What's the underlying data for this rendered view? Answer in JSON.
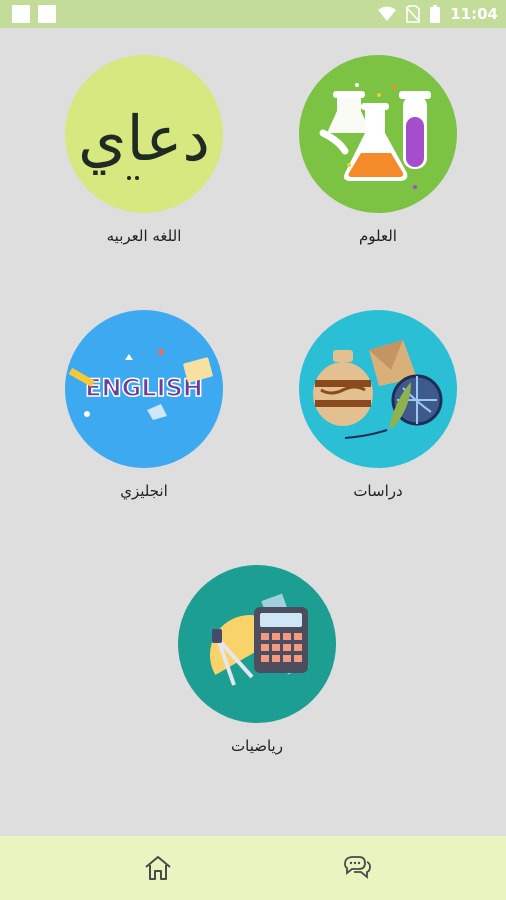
{
  "status_bar": {
    "time": "11:04",
    "icons": [
      "wifi-icon",
      "no-sim-icon",
      "battery-icon"
    ]
  },
  "subjects": [
    {
      "id": "science",
      "label": "العلوم",
      "icon": "chemistry-flasks-icon",
      "color": "#7cc243"
    },
    {
      "id": "arabic",
      "label": "اللغه العربيه",
      "icon": "arabic-calligraphy-icon",
      "color": "#d6e87f"
    },
    {
      "id": "studies",
      "label": "دراسات",
      "icon": "pottery-globe-icon",
      "color": "#2bbfd6"
    },
    {
      "id": "english",
      "label": "انجليزي",
      "icon": "english-word-icon",
      "color": "#3ca9f0"
    },
    {
      "id": "math",
      "label": "رياضيات",
      "icon": "calculator-ruler-icon",
      "color": "#1d9e93"
    }
  ],
  "calligraphy_text": "دعاي",
  "english_word": "ENGLISH",
  "bottom_nav": {
    "items": [
      {
        "id": "home",
        "icon": "home-icon"
      },
      {
        "id": "chat",
        "icon": "chat-icon"
      }
    ]
  }
}
